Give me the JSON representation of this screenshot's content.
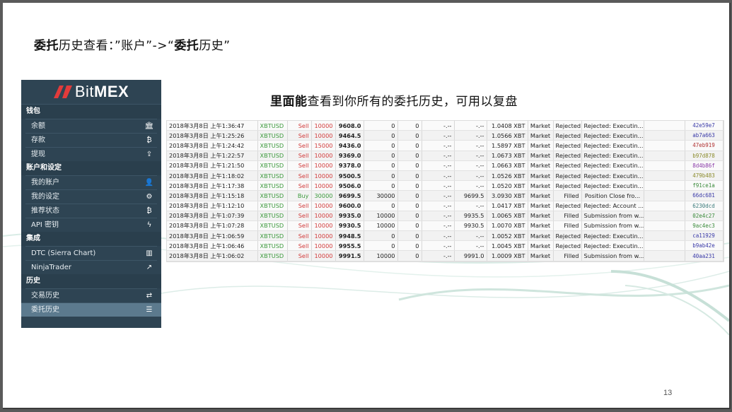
{
  "slide": {
    "title_bold": "委托",
    "title_rest": "历史查看：”账户”->“",
    "title_bold2": "委托",
    "title_end": "历史”",
    "caption_bold": "里面能",
    "caption_rest": "查看到你所有的委托历史，可用以复盘",
    "page_number": "13"
  },
  "colors": {
    "sidebar_bg": "#2e4453",
    "logo_red": "#e23b3b",
    "sell_red": "#d23c3c",
    "buy_green": "#3c9a3c"
  },
  "sidebar": {
    "logo_bit": "Bit",
    "logo_mex": "MEX",
    "sections": [
      {
        "title": "钱包",
        "items": [
          {
            "label": "余额",
            "icon": "bank-icon",
            "glyph": "🏛"
          },
          {
            "label": "存款",
            "icon": "bitcoin-icon",
            "glyph": "₿"
          },
          {
            "label": "提现",
            "icon": "upload-icon",
            "glyph": "⇪"
          }
        ]
      },
      {
        "title": "账户和设定",
        "items": [
          {
            "label": "我的账户",
            "icon": "user-icon",
            "glyph": "👤"
          },
          {
            "label": "我的设定",
            "icon": "gear-icon",
            "glyph": "⚙"
          },
          {
            "label": "推荐状态",
            "icon": "bitcoin-icon",
            "glyph": "₿"
          },
          {
            "label": "API 密钥",
            "icon": "bolt-icon",
            "glyph": "ϟ"
          }
        ]
      },
      {
        "title": "集成",
        "items": [
          {
            "label": "DTC (Sierra Chart)",
            "icon": "bar-chart-icon",
            "glyph": "▥"
          },
          {
            "label": "NinjaTrader",
            "icon": "line-chart-icon",
            "glyph": "↗"
          }
        ]
      },
      {
        "title": "历史",
        "items": [
          {
            "label": "交易历史",
            "icon": "exchange-icon",
            "glyph": "⇄"
          },
          {
            "label": "委托历史",
            "icon": "list-icon",
            "glyph": "☰",
            "active": true
          }
        ]
      }
    ]
  },
  "orders": [
    {
      "time": "2018年3月8日 上午1:36:47",
      "symbol": "XBTUSD",
      "side": "Sell",
      "qty": "10000",
      "price": "9608.0",
      "filled": "0",
      "display": "0",
      "stop": "-.--",
      "fill_price": "-.--",
      "value": "1.0408 XBT",
      "type": "Market",
      "status": "Rejected",
      "text": "Rejected: Executin...",
      "id": "42e59e7",
      "id_color": "#3a3aa8"
    },
    {
      "time": "2018年3月8日 上午1:25:26",
      "symbol": "XBTUSD",
      "side": "Sell",
      "qty": "10000",
      "price": "9464.5",
      "filled": "0",
      "display": "0",
      "stop": "-.--",
      "fill_price": "-.--",
      "value": "1.0566 XBT",
      "type": "Market",
      "status": "Rejected",
      "text": "Rejected: Executin...",
      "id": "ab7a663",
      "id_color": "#3a3aa8"
    },
    {
      "time": "2018年3月8日 上午1:24:42",
      "symbol": "XBTUSD",
      "side": "Sell",
      "qty": "15000",
      "price": "9436.0",
      "filled": "0",
      "display": "0",
      "stop": "-.--",
      "fill_price": "-.--",
      "value": "1.5897 XBT",
      "type": "Market",
      "status": "Rejected",
      "text": "Rejected: Executin...",
      "id": "47eb919",
      "id_color": "#b03030"
    },
    {
      "time": "2018年3月8日 上午1:22:57",
      "symbol": "XBTUSD",
      "side": "Sell",
      "qty": "10000",
      "price": "9369.0",
      "filled": "0",
      "display": "0",
      "stop": "-.--",
      "fill_price": "-.--",
      "value": "1.0673 XBT",
      "type": "Market",
      "status": "Rejected",
      "text": "Rejected: Executin...",
      "id": "b97d878",
      "id_color": "#8a8a2a"
    },
    {
      "time": "2018年3月8日 上午1:21:50",
      "symbol": "XBTUSD",
      "side": "Sell",
      "qty": "10000",
      "price": "9378.0",
      "filled": "0",
      "display": "0",
      "stop": "-.--",
      "fill_price": "-.--",
      "value": "1.0663 XBT",
      "type": "Market",
      "status": "Rejected",
      "text": "Rejected: Executin...",
      "id": "8d4b86f",
      "id_color": "#8a3aa8"
    },
    {
      "time": "2018年3月8日 上午1:18:02",
      "symbol": "XBTUSD",
      "side": "Sell",
      "qty": "10000",
      "price": "9500.5",
      "filled": "0",
      "display": "0",
      "stop": "-.--",
      "fill_price": "-.--",
      "value": "1.0526 XBT",
      "type": "Market",
      "status": "Rejected",
      "text": "Rejected: Executin...",
      "id": "479b483",
      "id_color": "#8a8a2a"
    },
    {
      "time": "2018年3月8日 上午1:17:38",
      "symbol": "XBTUSD",
      "side": "Sell",
      "qty": "10000",
      "price": "9506.0",
      "filled": "0",
      "display": "0",
      "stop": "-.--",
      "fill_price": "-.--",
      "value": "1.0520 XBT",
      "type": "Market",
      "status": "Rejected",
      "text": "Rejected: Executin...",
      "id": "f91ce1a",
      "id_color": "#3a8a3a"
    },
    {
      "time": "2018年3月8日 上午1:15:18",
      "symbol": "XBTUSD",
      "side": "Buy",
      "qty": "30000",
      "price": "9699.5",
      "filled": "30000",
      "display": "0",
      "stop": "-.--",
      "fill_price": "9699.5",
      "value": "3.0930 XBT",
      "type": "Market",
      "status": "Filled",
      "text": "Position Close fro...",
      "id": "66dc681",
      "id_color": "#3a3aa8"
    },
    {
      "time": "2018年3月8日 上午1:12:10",
      "symbol": "XBTUSD",
      "side": "Sell",
      "qty": "10000",
      "price": "9600.0",
      "filled": "0",
      "display": "0",
      "stop": "-.--",
      "fill_price": "-.--",
      "value": "1.0417 XBT",
      "type": "Market",
      "status": "Rejected",
      "text": "Rejected: Account ...",
      "id": "6230dcd",
      "id_color": "#3a7a7a"
    },
    {
      "time": "2018年3月8日 上午1:07:39",
      "symbol": "XBTUSD",
      "side": "Sell",
      "qty": "10000",
      "price": "9935.0",
      "filled": "10000",
      "display": "0",
      "stop": "-.--",
      "fill_price": "9935.5",
      "value": "1.0065 XBT",
      "type": "Market",
      "status": "Filled",
      "text": "Submission from w...",
      "id": "02e4c27",
      "id_color": "#3a8a3a"
    },
    {
      "time": "2018年3月8日 上午1:07:28",
      "symbol": "XBTUSD",
      "side": "Sell",
      "qty": "10000",
      "price": "9930.5",
      "filled": "10000",
      "display": "0",
      "stop": "-.--",
      "fill_price": "9930.5",
      "value": "1.0070 XBT",
      "type": "Market",
      "status": "Filled",
      "text": "Submission from w...",
      "id": "9ac4ec3",
      "id_color": "#3a8a3a"
    },
    {
      "time": "2018年3月8日 上午1:06:59",
      "symbol": "XBTUSD",
      "side": "Sell",
      "qty": "10000",
      "price": "9948.5",
      "filled": "0",
      "display": "0",
      "stop": "-.--",
      "fill_price": "-.--",
      "value": "1.0052 XBT",
      "type": "Market",
      "status": "Rejected",
      "text": "Rejected: Executin...",
      "id": "ca11929",
      "id_color": "#3a3aa8"
    },
    {
      "time": "2018年3月8日 上午1:06:46",
      "symbol": "XBTUSD",
      "side": "Sell",
      "qty": "10000",
      "price": "9955.5",
      "filled": "0",
      "display": "0",
      "stop": "-.--",
      "fill_price": "-.--",
      "value": "1.0045 XBT",
      "type": "Market",
      "status": "Rejected",
      "text": "Rejected: Executin...",
      "id": "b9ab42e",
      "id_color": "#3a3aa8"
    },
    {
      "time": "2018年3月8日 上午1:06:02",
      "symbol": "XBTUSD",
      "side": "Sell",
      "qty": "10000",
      "price": "9991.5",
      "filled": "10000",
      "display": "0",
      "stop": "-.--",
      "fill_price": "9991.0",
      "value": "1.0009 XBT",
      "type": "Market",
      "status": "Filled",
      "text": "Submission from w...",
      "id": "40aa231",
      "id_color": "#3a3aa8"
    }
  ]
}
